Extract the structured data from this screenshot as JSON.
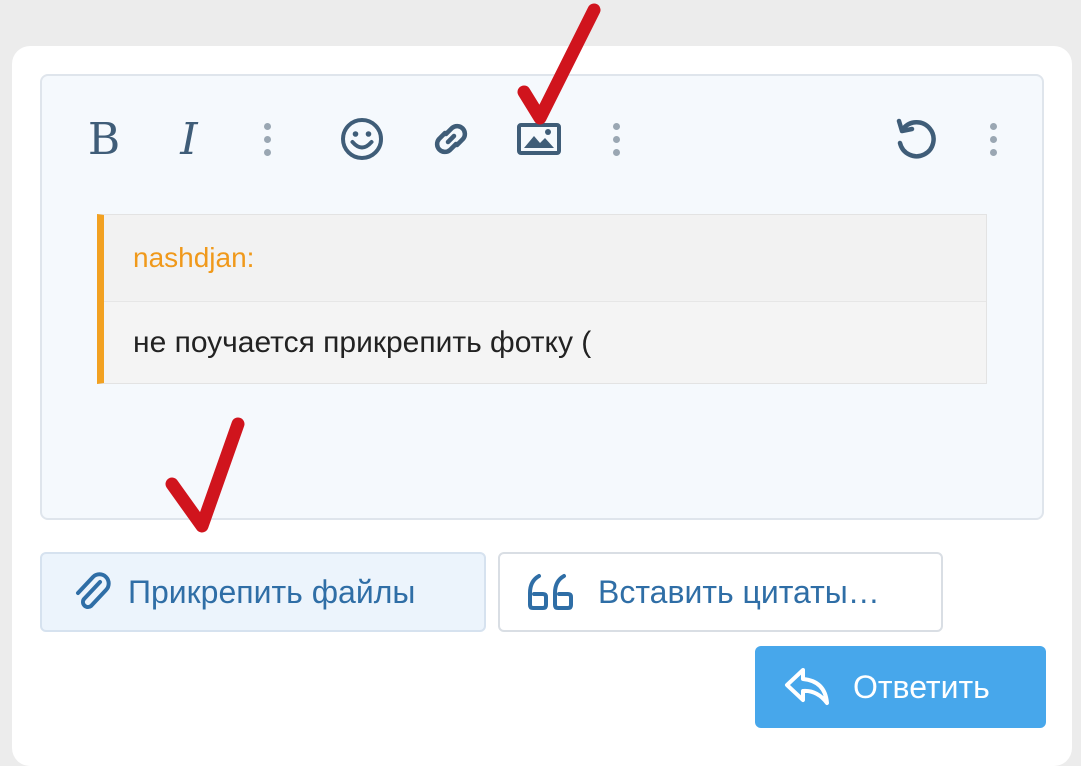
{
  "toolbar": {
    "bold_label": "B",
    "italic_label": "I",
    "icons": [
      "more-vertical-icon",
      "emoji-icon",
      "link-icon",
      "image-icon",
      "more-vertical-icon",
      "undo-icon",
      "more-vertical-icon"
    ]
  },
  "quote": {
    "author": "nashdjan:",
    "text": "не поучается прикрепить фотку ("
  },
  "actions": {
    "attach_label": "Прикрепить файлы",
    "insert_quotes_label": "Вставить цитаты…",
    "reply_label": "Ответить"
  },
  "colors": {
    "accent": "#47a7eb",
    "quote_border": "#f2a121",
    "quote_author": "#f0991b",
    "annotation": "#d0141d",
    "icon": "#3f5d78"
  }
}
